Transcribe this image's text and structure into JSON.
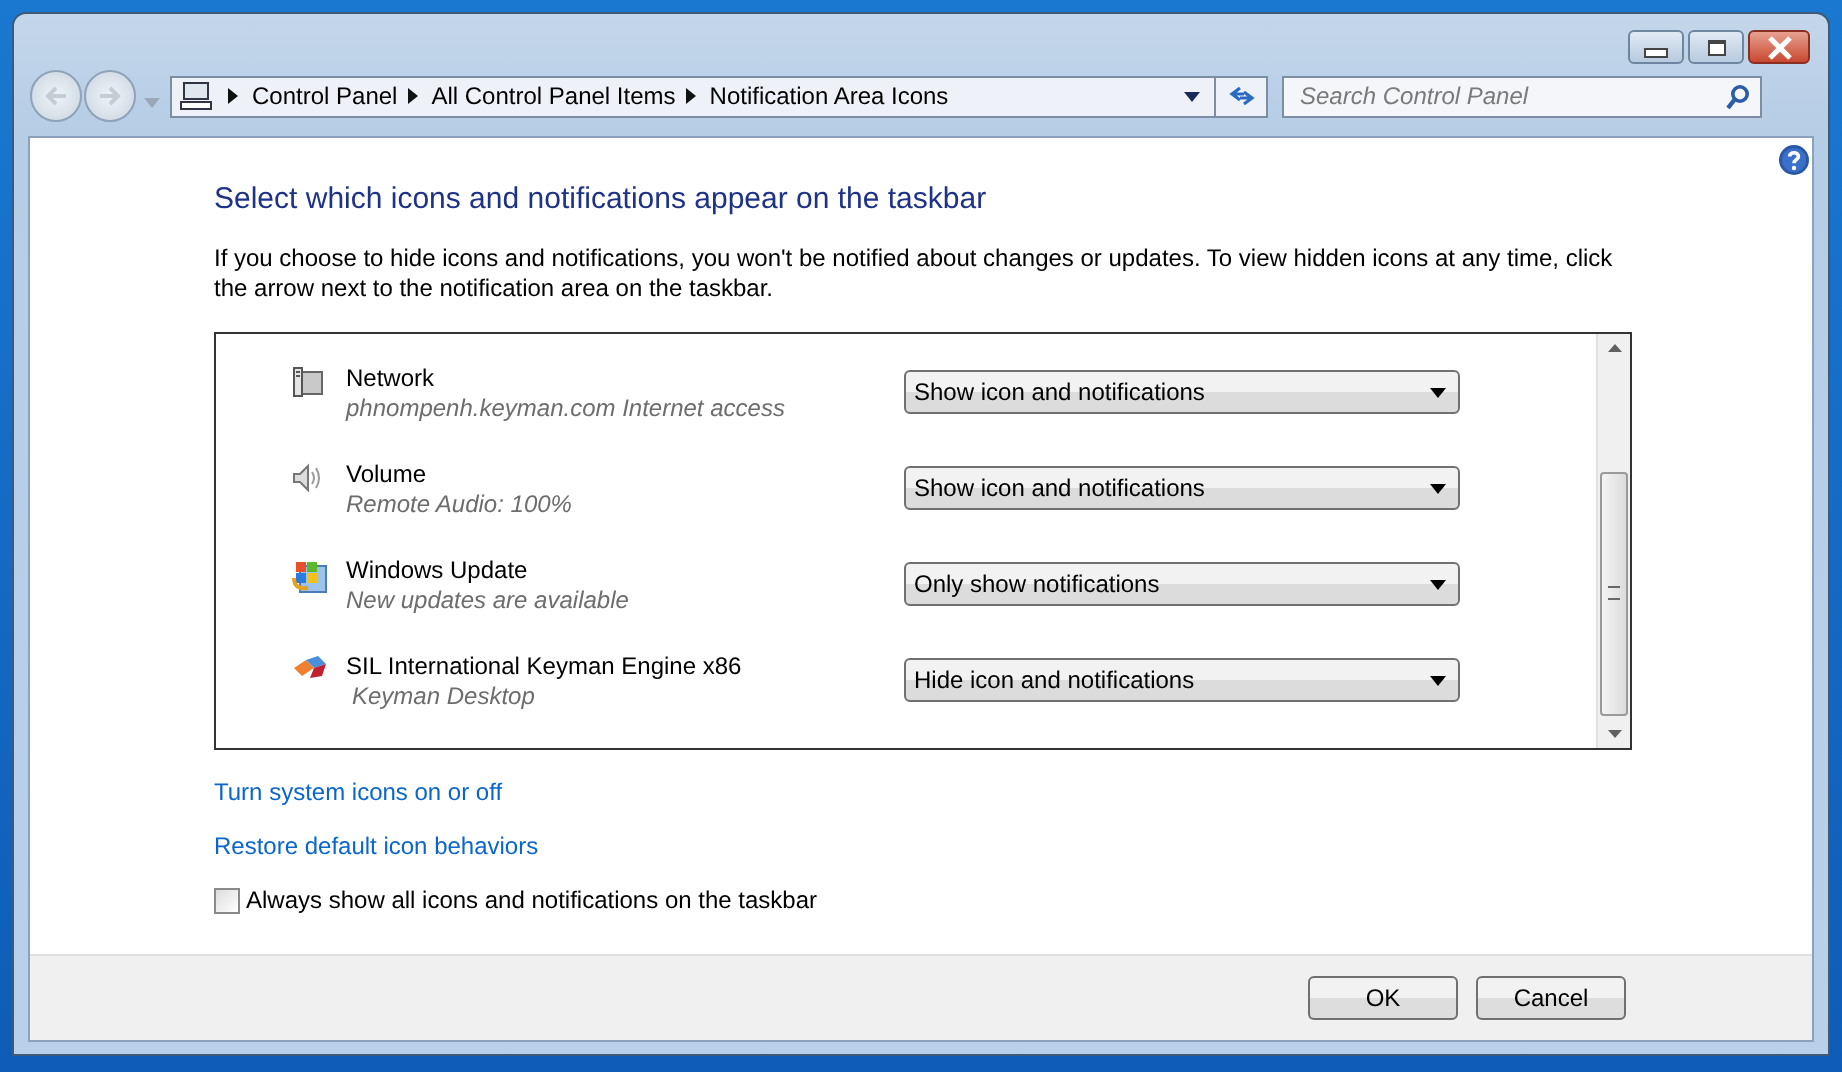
{
  "address_bar": {
    "breadcrumbs": [
      "Control Panel",
      "All Control Panel Items",
      "Notification Area Icons"
    ]
  },
  "search": {
    "placeholder": "Search Control Panel"
  },
  "heading": "Select which icons and notifications appear on the taskbar",
  "description": "If you choose to hide icons and notifications, you won't be notified about changes or updates. To view hidden icons at any time, click the arrow next to the notification area on the taskbar.",
  "icons": [
    {
      "name": "Network",
      "detail": "phnompenh.keyman.com Internet access",
      "behavior": "Show icon and notifications"
    },
    {
      "name": "Volume",
      "detail": "Remote Audio: 100%",
      "behavior": "Show icon and notifications"
    },
    {
      "name": "Windows Update",
      "detail": "New updates are available",
      "behavior": "Only show notifications"
    },
    {
      "name": "SIL International Keyman Engine x86",
      "detail": "Keyman Desktop",
      "behavior": "Hide icon and notifications"
    }
  ],
  "links": [
    "Turn system icons on or off",
    "Restore default icon behaviors"
  ],
  "always_show": {
    "label": "Always show all icons and notifications on the taskbar",
    "checked": false
  },
  "buttons": [
    "OK",
    "Cancel"
  ]
}
